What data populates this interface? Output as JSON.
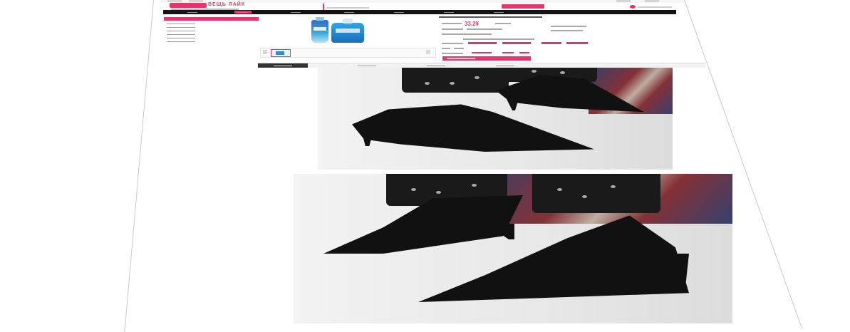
{
  "store": {
    "logo_text": "ВЕЩЬ ЛАЙК"
  },
  "product": {
    "price": "33.2¥"
  },
  "colors": {
    "accent": "#e8336d",
    "nav_bg": "#141414"
  },
  "icons": {
    "logo": "brand-logo-icon",
    "search": "search-icon",
    "cart": "cart-icon"
  }
}
